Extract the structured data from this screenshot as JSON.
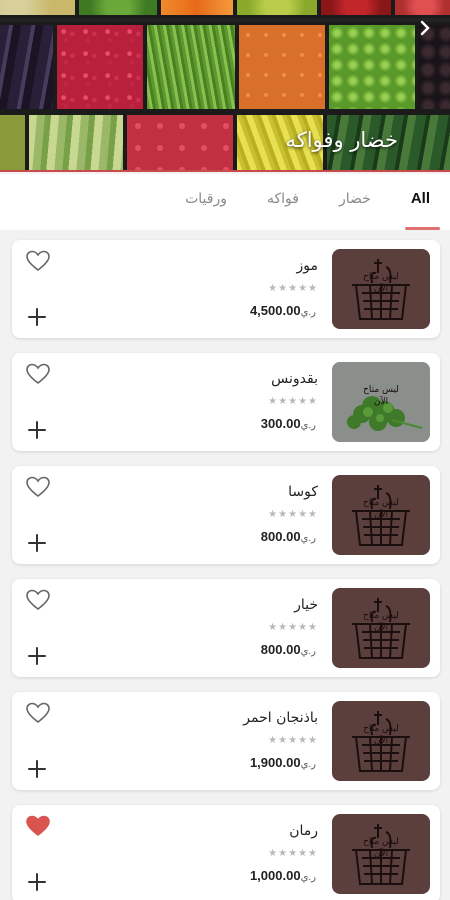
{
  "hero": {
    "title": "خضار وفواكه",
    "next_icon": "chevron-right-icon"
  },
  "tabs": [
    {
      "label": "All",
      "active": true
    },
    {
      "label": "خضار",
      "active": false
    },
    {
      "label": "فواكه",
      "active": false
    },
    {
      "label": "ورقيات",
      "active": false
    }
  ],
  "products": [
    {
      "name": "موز",
      "price": "4,500.00",
      "currency": "ر.ي",
      "rating_stars": "★★★★★",
      "favorite": false,
      "image": "placeholder-basket"
    },
    {
      "name": "بقدونس",
      "price": "300.00",
      "currency": "ر.ي",
      "rating_stars": "★★★★★",
      "favorite": false,
      "image": "parsley-photo"
    },
    {
      "name": "كوسا",
      "price": "800.00",
      "currency": "ر.ي",
      "rating_stars": "★★★★★",
      "favorite": false,
      "image": "placeholder-basket"
    },
    {
      "name": "خيار",
      "price": "800.00",
      "currency": "ر.ي",
      "rating_stars": "★★★★★",
      "favorite": false,
      "image": "placeholder-basket"
    },
    {
      "name": "باذنجان احمر",
      "price": "1,900.00",
      "currency": "ر.ي",
      "rating_stars": "★★★★★",
      "favorite": false,
      "image": "placeholder-basket"
    },
    {
      "name": "رمان",
      "price": "1,000.00",
      "currency": "ر.ي",
      "rating_stars": "★★★★★",
      "favorite": true,
      "image": "placeholder-basket"
    }
  ],
  "colors": {
    "accent": "#e07070",
    "favorite_active": "#d9534f",
    "placeholder_bg": "#5b3f3d"
  }
}
